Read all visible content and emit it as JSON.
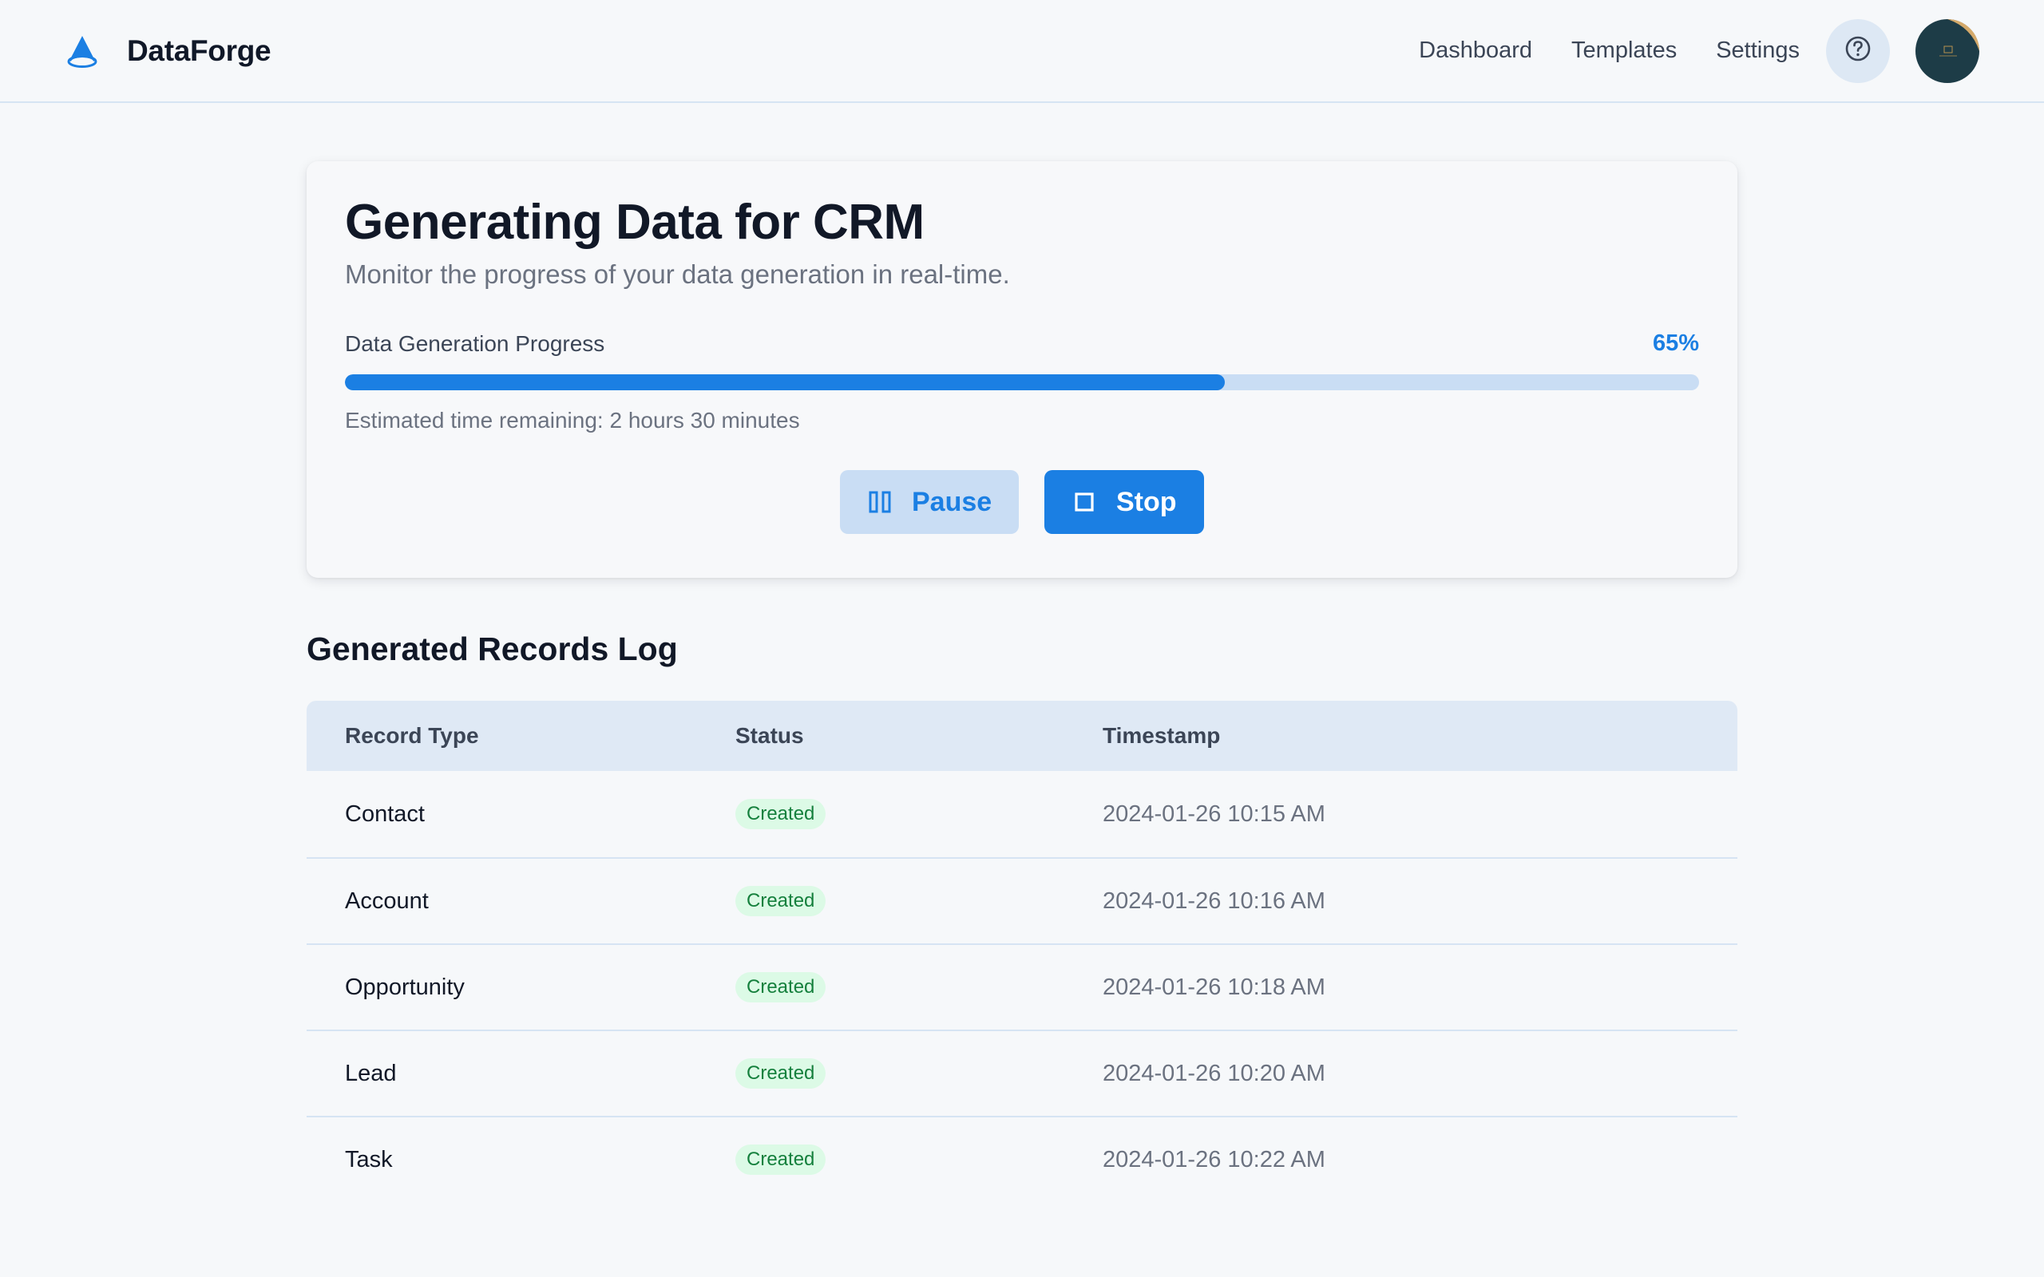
{
  "header": {
    "brand": "DataForge",
    "nav": [
      {
        "label": "Dashboard"
      },
      {
        "label": "Templates"
      },
      {
        "label": "Settings"
      }
    ],
    "help_icon": "question-circle-icon"
  },
  "card": {
    "title": "Generating Data for CRM",
    "subtitle": "Monitor the progress of your data generation in real-time.",
    "progress_label": "Data Generation Progress",
    "progress_percent_text": "65%",
    "progress_value": 0.65,
    "eta": "Estimated time remaining: 2 hours 30 minutes",
    "pause_label": "Pause",
    "stop_label": "Stop"
  },
  "log": {
    "title": "Generated Records Log",
    "columns": [
      "Record Type",
      "Status",
      "Timestamp"
    ],
    "rows": [
      {
        "type": "Contact",
        "status": "Created",
        "time": "2024-01-26 10:15 AM"
      },
      {
        "type": "Account",
        "status": "Created",
        "time": "2024-01-26 10:16 AM"
      },
      {
        "type": "Opportunity",
        "status": "Created",
        "time": "2024-01-26 10:18 AM"
      },
      {
        "type": "Lead",
        "status": "Created",
        "time": "2024-01-26 10:20 AM"
      },
      {
        "type": "Task",
        "status": "Created",
        "time": "2024-01-26 10:22 AM"
      }
    ]
  },
  "colors": {
    "accent": "#1b7fe3",
    "accent_light": "#c9ddf4",
    "status_created_bg": "#dcfae6",
    "status_created_text": "#15803d"
  }
}
